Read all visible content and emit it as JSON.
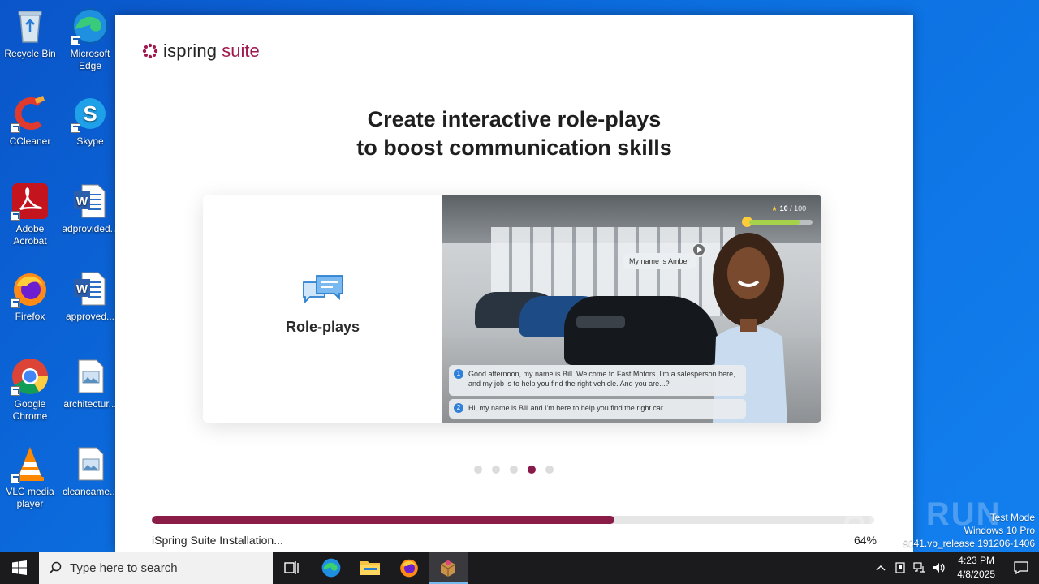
{
  "desktop": {
    "icons": [
      {
        "label": "Recycle Bin",
        "icon": "recycle-bin-icon"
      },
      {
        "label": "Microsoft Edge",
        "icon": "edge-icon"
      },
      {
        "label": "CCleaner",
        "icon": "ccleaner-icon"
      },
      {
        "label": "Skype",
        "icon": "skype-icon"
      },
      {
        "label": "Adobe Acrobat",
        "icon": "acrobat-icon"
      },
      {
        "label": "adprovided...",
        "icon": "word-document-icon"
      },
      {
        "label": "Firefox",
        "icon": "firefox-icon"
      },
      {
        "label": "approved...",
        "icon": "word-document-icon"
      },
      {
        "label": "Google Chrome",
        "icon": "chrome-icon"
      },
      {
        "label": "architectur...",
        "icon": "image-file-icon"
      },
      {
        "label": "VLC media player",
        "icon": "vlc-icon"
      },
      {
        "label": "cleancame...",
        "icon": "image-file-icon"
      }
    ]
  },
  "installer": {
    "logo_ispring": "ispring",
    "logo_suite": "suite",
    "headline_line1": "Create interactive role-plays",
    "headline_line2": "to boost communication skills",
    "card": {
      "feature_label": "Role-plays",
      "score": "10",
      "score_max": "/ 100",
      "score_progress": 0.8,
      "bubble_name": "My name is Amber",
      "replies": [
        {
          "num": "1",
          "text": "Good afternoon, my name is Bill. Welcome to Fast Motors. I'm a salesperson here, and my job is to help you find the right vehicle. And you are...?"
        },
        {
          "num": "2",
          "text": "Hi, my name is Bill and I'm here to help you find the right car."
        }
      ]
    },
    "carousel": {
      "count": 5,
      "active_index": 3
    },
    "progress": {
      "value": 0.64,
      "percent_label": "64%",
      "status_text": "iSpring Suite Installation..."
    },
    "colors": {
      "brand": "#8a1d47",
      "track": "#e6e6e6"
    }
  },
  "watermark": {
    "text": "ANY RUN"
  },
  "windows_info": {
    "line1": "Test Mode",
    "line2": "Windows 10 Pro",
    "line3": "9041.vb_release.191206-1406"
  },
  "taskbar": {
    "search_placeholder": "Type here to search",
    "clock_time": "4:23 PM",
    "clock_date": "4/8/2025",
    "pinned": [
      "task-view-icon",
      "edge-icon",
      "file-explorer-icon",
      "firefox-icon",
      "installer-icon"
    ]
  }
}
